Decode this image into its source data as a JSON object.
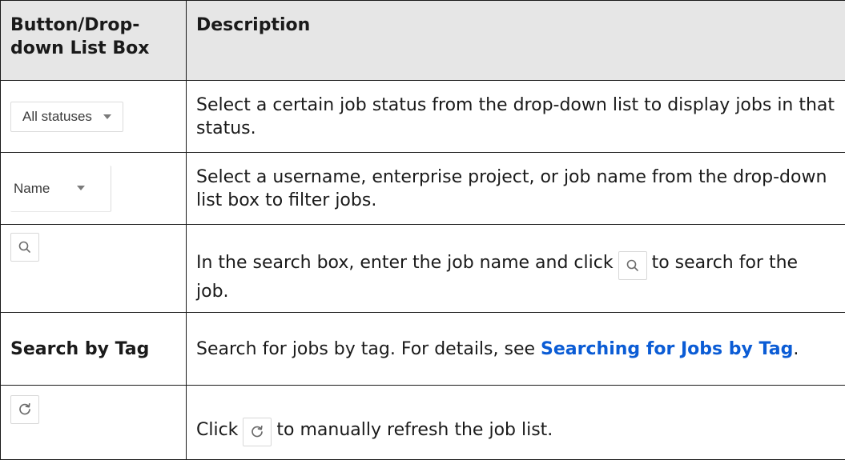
{
  "header": {
    "col1": "Button/Drop-down List Box",
    "col2": "Description"
  },
  "rows": [
    {
      "control": "All statuses",
      "description": "Select a certain job status from the drop-down list to display jobs in that status."
    },
    {
      "control": "Name",
      "description": "Select a username, enterprise project, or job name from the drop-down list box to filter jobs."
    },
    {
      "description_before": "In the search box, enter the job name and click",
      "description_after": "to search for the job."
    },
    {
      "control": "Search by Tag",
      "description_before": "Search for jobs by tag. For details, see ",
      "link": "Searching for Jobs by Tag",
      "description_after": "."
    },
    {
      "description_before": "Click",
      "description_after": "to manually refresh the job list."
    }
  ],
  "icons": {
    "search": "search-icon",
    "refresh": "refresh-icon"
  },
  "colors": {
    "header_bg": "#e6e6e6",
    "link": "#0b5cd5"
  }
}
